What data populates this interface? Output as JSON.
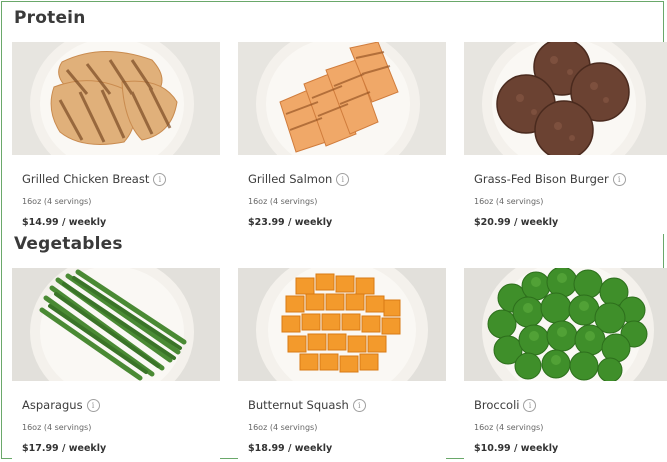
{
  "sections": [
    {
      "title": "Protein",
      "items": [
        {
          "name": "Grilled Chicken Breast",
          "size": "16oz (4 servings)",
          "price": "$14.99 / weekly",
          "image": "grilled-chicken-photo"
        },
        {
          "name": "Grilled Salmon",
          "size": "16oz (4 servings)",
          "price": "$23.99 / weekly",
          "image": "grilled-salmon-photo"
        },
        {
          "name": "Grass-Fed Bison Burger",
          "size": "16oz (4 servings)",
          "price": "$20.99 / weekly",
          "image": "bison-burger-photo"
        }
      ]
    },
    {
      "title": "Vegetables",
      "items": [
        {
          "name": "Asparagus",
          "size": "16oz (4 servings)",
          "price": "$17.99 / weekly",
          "image": "asparagus-photo"
        },
        {
          "name": "Butternut Squash",
          "size": "16oz (4 servings)",
          "price": "$18.99 / weekly",
          "image": "butternut-squash-photo"
        },
        {
          "name": "Broccoli",
          "size": "16oz (4 servings)",
          "price": "$10.99 / weekly",
          "image": "broccoli-photo"
        }
      ]
    }
  ],
  "info_glyph": "i",
  "colors": {
    "frame_border": "#6aa86a",
    "photo_bg": "#e6e4df",
    "plate": "#f4f1ec"
  }
}
